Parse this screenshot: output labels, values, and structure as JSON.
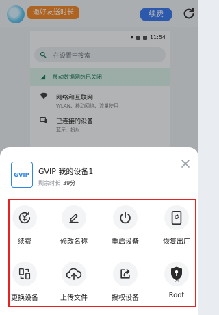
{
  "app": {
    "promo_label": "邀好友送时长",
    "renew_label": "续费"
  },
  "phone": {
    "time": "11:54",
    "search_placeholder": "在设置中搜索",
    "notice": "移动数据网络已关闭",
    "rows": [
      {
        "title": "网络和互联网",
        "subtitle": "WLAN、移动网络、流量使用"
      },
      {
        "title": "已连接的设备",
        "subtitle": "蓝牙、投射"
      }
    ]
  },
  "sheet": {
    "badge_text": "GVIP",
    "device_title": "GVIP 我的设备1",
    "remaining_label": "剩余时长",
    "remaining_value": "39分",
    "actions": [
      {
        "label": "续费",
        "icon": "yen-renew-icon"
      },
      {
        "label": "修改名称",
        "icon": "pencil-icon"
      },
      {
        "label": "重启设备",
        "icon": "power-icon"
      },
      {
        "label": "恢复出厂",
        "icon": "factory-reset-icon"
      },
      {
        "label": "更换设备",
        "icon": "swap-device-icon"
      },
      {
        "label": "上传文件",
        "icon": "cloud-upload-icon"
      },
      {
        "label": "授权设备",
        "icon": "share-authorize-icon"
      },
      {
        "label": "Root",
        "icon": "root-shield-icon"
      }
    ],
    "root_icon_text": "ON"
  },
  "colors": {
    "accent_blue": "#3f7cf0",
    "promo_orange": "#f28a2e",
    "highlight_red": "#e52421",
    "gvip_blue": "#2f86e4"
  }
}
